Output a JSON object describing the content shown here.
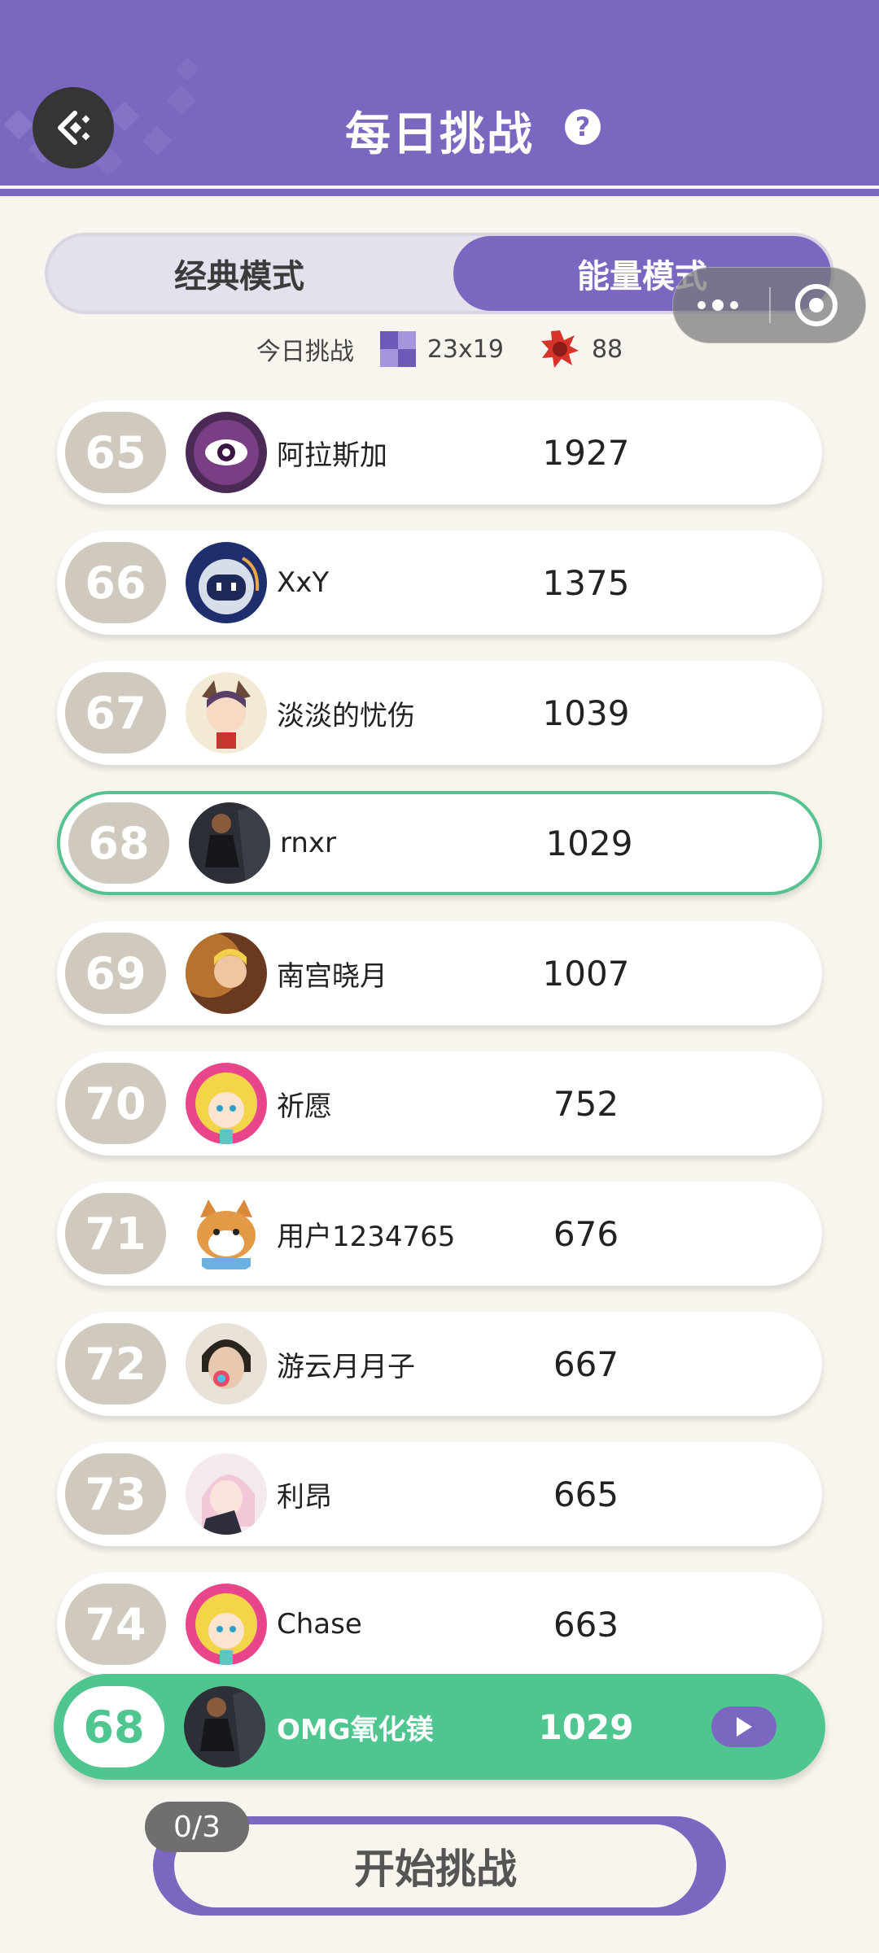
{
  "header": {
    "title": "每日挑战",
    "help_label": "?"
  },
  "tabs": [
    {
      "label": "经典模式",
      "active": false
    },
    {
      "label": "能量模式",
      "active": true
    }
  ],
  "info": {
    "label": "今日挑战",
    "grid_size": "23x19",
    "energy": "88"
  },
  "leaderboard": [
    {
      "rank": "65",
      "name": "阿拉斯加",
      "score": "1927"
    },
    {
      "rank": "66",
      "name": "XxY",
      "score": "1375"
    },
    {
      "rank": "67",
      "name": "淡淡的忧伤",
      "score": "1039"
    },
    {
      "rank": "68",
      "name": "rnxr",
      "score": "1029"
    },
    {
      "rank": "69",
      "name": "南宫晓月",
      "score": "1007"
    },
    {
      "rank": "70",
      "name": "祈愿",
      "score": "752"
    },
    {
      "rank": "71",
      "name": "用户1234765",
      "score": "676"
    },
    {
      "rank": "72",
      "name": "游云月月子",
      "score": "667"
    },
    {
      "rank": "73",
      "name": "利昂",
      "score": "665"
    },
    {
      "rank": "74",
      "name": "Chase",
      "score": "663"
    }
  ],
  "my_entry": {
    "rank": "68",
    "name": "OMG氧化镁",
    "score": "1029"
  },
  "start": {
    "label": "开始挑战",
    "attempts": "0/3"
  },
  "colors": {
    "brand": "#7b66c0",
    "accent": "#4fc58f",
    "rank_bg": "#cfcabd"
  }
}
